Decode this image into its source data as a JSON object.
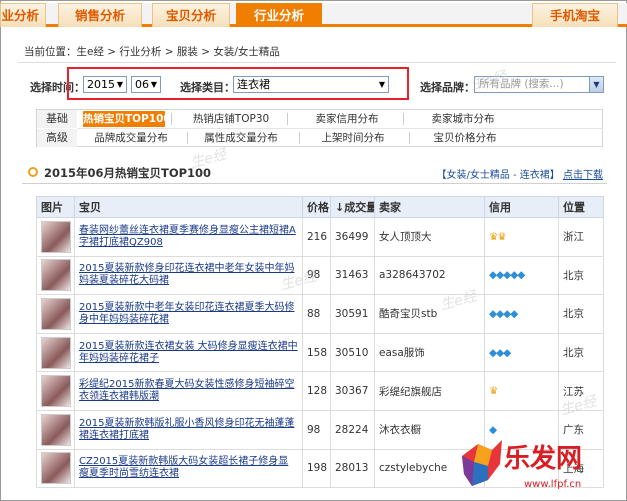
{
  "nav": {
    "tabs": [
      {
        "label": "业分析"
      },
      {
        "label": "销售分析"
      },
      {
        "label": "宝贝分析"
      },
      {
        "label": "行业分析"
      },
      {
        "label": "手机淘宝"
      }
    ]
  },
  "breadcrumb": "当前位置：生e经 > 行业分析 > 服装 > 女装/女士精品",
  "filters": {
    "time_label": "选择时间：",
    "year": "2015",
    "month": "06",
    "category_label": "选择类目：",
    "category": "连衣裙",
    "brand_label": "选择品牌：",
    "brand_placeholder": "所有品牌 (搜索...)"
  },
  "subnav": {
    "row1_label": "基础",
    "row2_label": "高级",
    "row1": [
      "热销宝贝TOP100",
      "热销店铺TOP30",
      "卖家信用分布",
      "卖家城市分布"
    ],
    "row2": [
      "品牌成交量分布",
      "属性成交量分布",
      "上架时间分布",
      "宝贝价格分布"
    ]
  },
  "section": {
    "title": "2015年06月热销宝贝TOP100",
    "category_link": "【女装/女士精品 - 连衣裙】",
    "download": "点击下载"
  },
  "table": {
    "headers": [
      "图片",
      "宝贝",
      "价格",
      "↓成交量",
      "卖家",
      "信用",
      "位置"
    ],
    "rows": [
      {
        "title": "春装网纱蕾丝连衣裙夏季赛修身显瘦公主裙短裙A字裙打底裙QZ908",
        "price": "216",
        "volume": "36499",
        "seller": "女人顶顶大",
        "credit": "♛♛",
        "location": "浙江"
      },
      {
        "title": "2015夏装新款修身印花连衣裙中老年女装中年妈妈装夏装碎花大码裙",
        "price": "98",
        "volume": "31463",
        "seller": "a328643702",
        "credit": "◆◆◆◆◆",
        "location": "北京"
      },
      {
        "title": "2015夏装新款中老年女装印花连衣裙夏季大码修身中年妈妈装碎花裙",
        "price": "88",
        "volume": "30591",
        "seller": "酷奇宝贝stb",
        "credit": "◆◆◆◆",
        "location": "北京"
      },
      {
        "title": "2015夏装新款连衣裙女装 大码修身显瘦连衣裙中年妈妈装碎花裙子",
        "price": "158",
        "volume": "30510",
        "seller": "easa服饰",
        "credit": "◆◆◆",
        "location": "北京"
      },
      {
        "title": "彩缇纪2015新款春夏大码女装性感修身短袖碎空衣领连衣裙韩版潮",
        "price": "128",
        "volume": "30367",
        "seller": "彩缇纪旗舰店",
        "credit": "♛",
        "location": "江苏"
      },
      {
        "title": "2015夏装新款韩版礼服小香风修身印花无袖蓬蓬裙连衣裙打底裙",
        "price": "98",
        "volume": "28224",
        "seller": "沐衣衣橱",
        "credit": "◆",
        "location": "广东"
      },
      {
        "title": "CZ2015夏装新款韩版大码女装超长裙子修身显瘦夏季时尚雪纺连衣裙",
        "price": "198",
        "married": "",
        "volume": "28013",
        "seller": "czstylebyche",
        "credit": "",
        "location": "上海"
      }
    ]
  },
  "watermark": "生e经",
  "logo": {
    "text": "乐发网",
    "url": "www.lfpf.cn"
  }
}
